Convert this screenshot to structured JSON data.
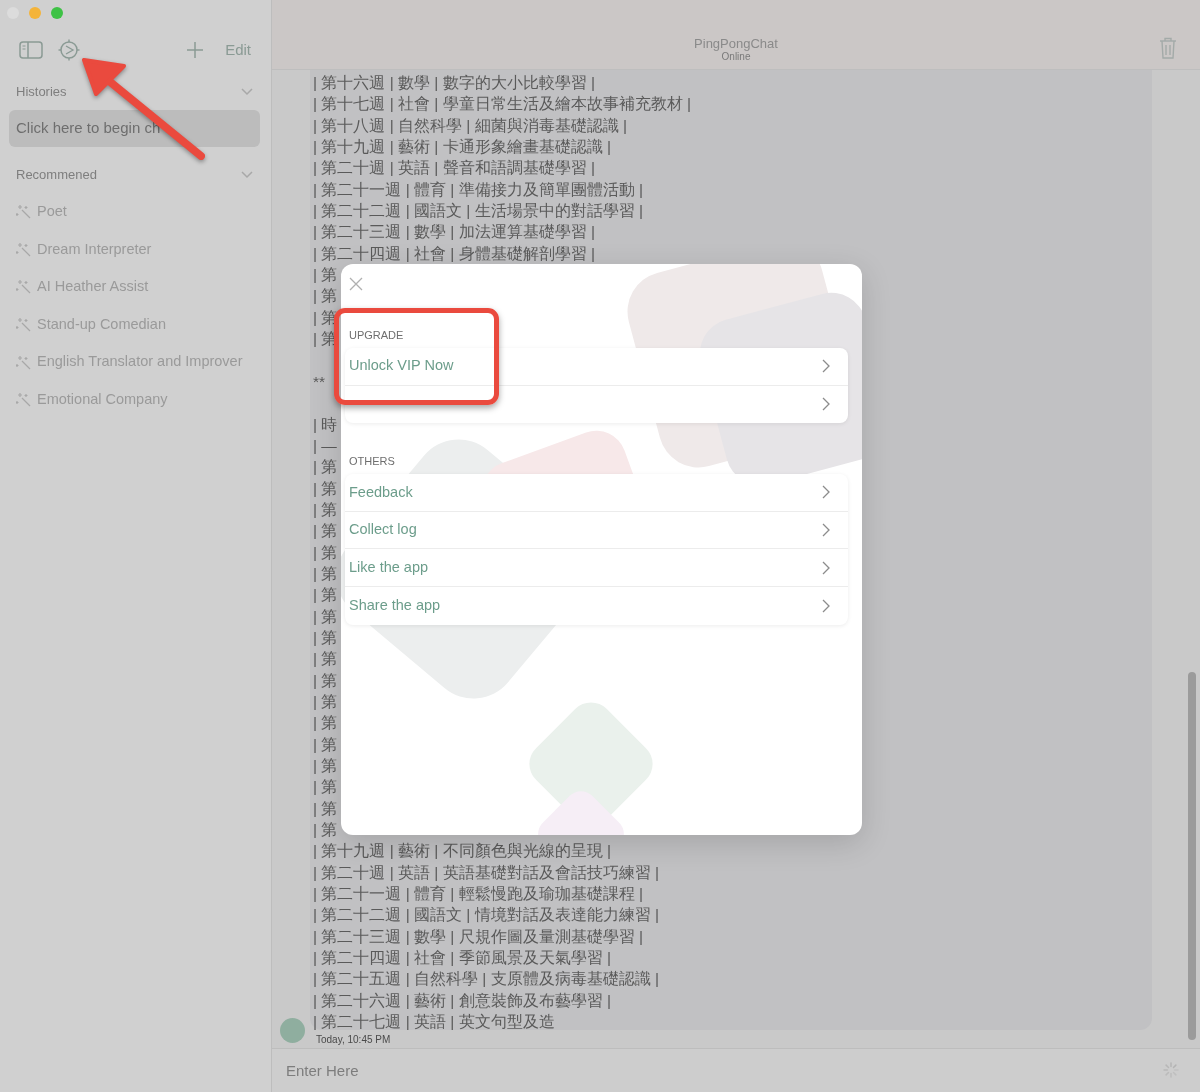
{
  "window": {
    "title": "PingPongChat",
    "status": "Online"
  },
  "sidebar": {
    "edit_label": "Edit",
    "sections": [
      {
        "title": "Histories",
        "expanded": true,
        "items": [
          {
            "kind": "history",
            "label": "Click here to begin ch",
            "selected": true
          }
        ]
      },
      {
        "title": "Recommened",
        "expanded": true,
        "items": [
          {
            "kind": "prompt",
            "label": "Poet",
            "selected": false
          },
          {
            "kind": "prompt",
            "label": "Dream Interpreter",
            "selected": false
          },
          {
            "kind": "prompt",
            "label": "AI Heather Assist",
            "selected": false
          },
          {
            "kind": "prompt",
            "label": "Stand-up Comedian",
            "selected": false
          },
          {
            "kind": "prompt",
            "label": "English Translator and Improver",
            "selected": false
          },
          {
            "kind": "prompt",
            "label": "Emotional Company",
            "selected": false
          }
        ]
      }
    ]
  },
  "chat": {
    "paragraphs": [
      [
        "| 第十六週 | 數學 | 數字的大小比較學習 |",
        "| 第十七週 | 社會 | 學童日常生活及繪本故事補充教材 |",
        "| 第十八週 | 自然科學 | 細菌與消毒基礎認識 |",
        "| 第十九週 | 藝術 | 卡通形象繪畫基礎認識 |",
        "| 第二十週 | 英語 | 聲音和語調基礎學習 |",
        "| 第二十一週 | 體育 | 準備接力及簡單團體活動 |",
        "| 第二十二週 | 國語文 | 生活場景中的對話學習 |",
        "| 第二十三週 | 數學 | 加法運算基礎學習 |",
        "| 第二十四週 | 社會 | 身體基礎解剖學習 |",
        "| 第",
        "| 第",
        "| 第",
        "| 第"
      ],
      [
        "**"
      ],
      [
        "| 時",
        "| —",
        "| 第",
        "| 第",
        "| 第",
        "| 第",
        "| 第",
        "| 第",
        "| 第",
        "| 第",
        "| 第",
        "| 第",
        "| 第",
        "| 第",
        "| 第",
        "| 第",
        "| 第",
        "| 第",
        "| 第",
        "| 第",
        "| 第十九週 | 藝術 | 不同顏色與光線的呈現 |",
        "| 第二十週 | 英語 | 英語基礎對話及會話技巧練習 |",
        "| 第二十一週 | 體育 | 輕鬆慢跑及瑜珈基礎課程 |",
        "| 第二十二週 | 國語文 | 情境對話及表達能力練習 |",
        "| 第二十三週 | 數學 | 尺規作圖及量測基礎學習 |",
        "| 第二十四週 | 社會 | 季節風景及天氣學習 |",
        "| 第二十五週 | 自然科學 | 支原體及病毒基礎認識 |",
        "| 第二十六週 | 藝術 | 創意裝飾及布藝學習 |",
        "| 第二十七週 | 英語 | 英文句型及造"
      ]
    ],
    "timestamp": "Today, 10:45 PM"
  },
  "composer": {
    "placeholder": "Enter Here"
  },
  "settings_dialog": {
    "sections": [
      {
        "title": "UPGRADE",
        "rows": [
          {
            "kind": "link",
            "label": "Unlock VIP Now"
          },
          {
            "kind": "covered"
          }
        ]
      },
      {
        "title": "OTHERS",
        "rows": [
          {
            "kind": "link",
            "label": "Feedback"
          },
          {
            "kind": "link",
            "label": "Collect log"
          },
          {
            "kind": "link",
            "label": "Like the app"
          },
          {
            "kind": "link",
            "label": "Share the app"
          }
        ]
      }
    ]
  },
  "annotations": {
    "arrow_to_settings": true,
    "frame_on_upgrade": true
  }
}
